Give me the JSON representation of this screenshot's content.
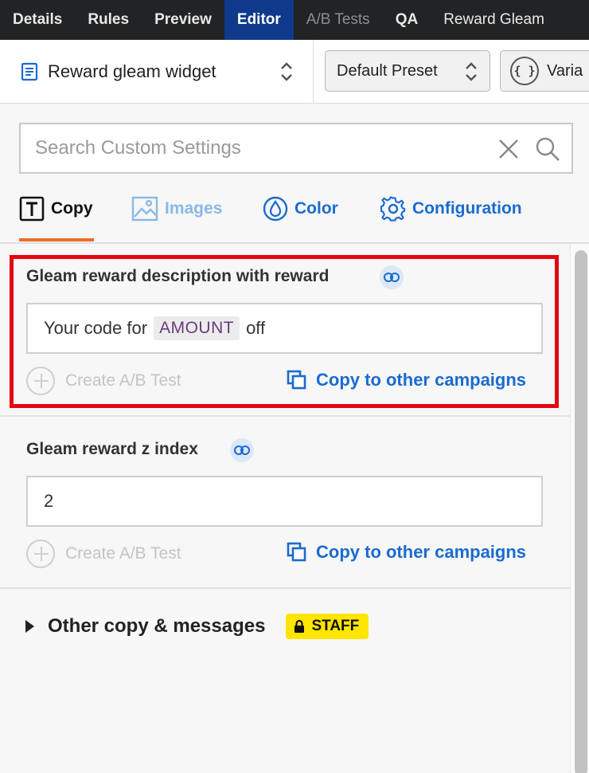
{
  "nav": {
    "tabs": [
      "Details",
      "Rules",
      "Preview",
      "Editor",
      "A/B Tests",
      "QA",
      "Reward Gleam"
    ],
    "active": "Editor"
  },
  "toolbar": {
    "widget_name": "Reward gleam widget",
    "preset": "Default Preset",
    "variables_label": "Varia"
  },
  "search": {
    "placeholder": "Search Custom Settings",
    "value": ""
  },
  "categories": {
    "copy": "Copy",
    "images": "Images",
    "color": "Color",
    "configuration": "Configuration"
  },
  "settings": [
    {
      "label": "Gleam reward description with reward",
      "value_prefix": "Your code for",
      "value_token": "AMOUNT",
      "value_suffix": "off",
      "ab_label": "Create A/B Test",
      "copy_label": "Copy to other campaigns"
    },
    {
      "label": "Gleam reward z index",
      "value": "2",
      "ab_label": "Create A/B Test",
      "copy_label": "Copy to other campaigns"
    }
  ],
  "other_section": {
    "label": "Other copy & messages",
    "badge": "STAFF"
  },
  "colors": {
    "accent_blue": "#1a6bd0",
    "active_tab": "#0f3a8c",
    "highlight_red": "#e30613",
    "tab_underline": "#ef6b2a",
    "staff_badge": "#ffe600"
  }
}
